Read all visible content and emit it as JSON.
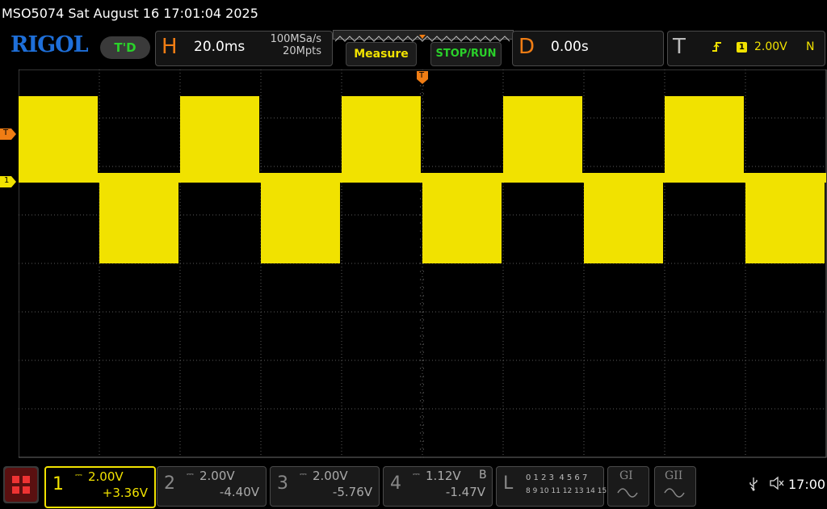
{
  "title": "MSO5074  Sat August 16 17:01:04 2025",
  "logo": "RIGOL",
  "mode_badge": "T'D",
  "horizontal": {
    "letter": "H",
    "timebase": "20.0ms",
    "sample_rate": "100MSa/s",
    "memory_depth": "20Mpts"
  },
  "buttons": {
    "measure": "Measure",
    "stop_run": "STOP/RUN"
  },
  "delay": {
    "letter": "D",
    "value": "0.00s"
  },
  "trigger": {
    "letter": "T",
    "source": "1",
    "level": "2.00V",
    "mode": "N"
  },
  "markers": {
    "trigger_level": "T",
    "channel1": "1",
    "trigger_pos": "T"
  },
  "channels": [
    {
      "num": "1",
      "scale": "2.00V",
      "offset": "+3.36V",
      "active": true,
      "color": "#f1e200",
      "extra": ""
    },
    {
      "num": "2",
      "scale": "2.00V",
      "offset": "-4.40V",
      "active": false,
      "color": "#aaaaaa",
      "extra": ""
    },
    {
      "num": "3",
      "scale": "2.00V",
      "offset": "-5.76V",
      "active": false,
      "color": "#aaaaaa",
      "extra": ""
    },
    {
      "num": "4",
      "scale": "1.12V",
      "offset": "-1.47V",
      "active": false,
      "color": "#aaaaaa",
      "extra": "B"
    }
  ],
  "logic": {
    "letter": "L",
    "row1": "0 1 2 3  4 5 6 7",
    "row2": "8 9 10 11 12 13 14 15"
  },
  "generators": [
    {
      "label": "GI"
    },
    {
      "label": "GII"
    }
  ],
  "status": {
    "clock": "17:00",
    "usb_icon": "usb-icon",
    "volume_icon": "volume-muted-icon"
  },
  "colors": {
    "ch1": "#f1e200",
    "trigger": "#f07d14",
    "grid": "#6a6a6a"
  },
  "waveform": {
    "type": "square-burst",
    "segments": [
      "high",
      "low",
      "high",
      "low",
      "high",
      "low",
      "high",
      "low",
      "high",
      "low"
    ],
    "divisions_per_segment": 1
  }
}
